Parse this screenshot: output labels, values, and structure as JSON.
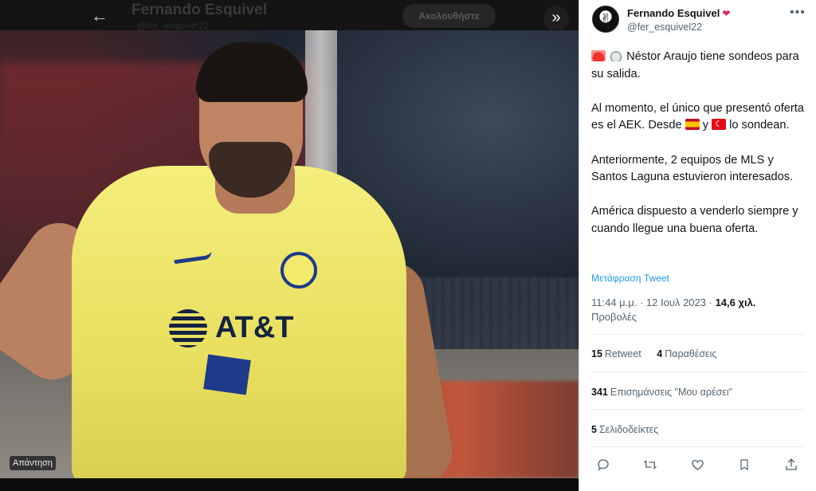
{
  "viewer": {
    "ghost_name": "Fernando Esquivel",
    "ghost_handle": "@fer_esquivel22",
    "follow_label": "Ακολουθήστε",
    "reply_label": "Απάντηση",
    "photo_sponsor": "AT&T"
  },
  "author": {
    "name": "Fernando Esquivel",
    "handle": "@fer_esquivel22",
    "badge_icon": "heart-red-icon"
  },
  "tweet": {
    "line1": "Néstor Araujo tiene sondeos para su salida.",
    "line2_a": "Al momento, el único que presentó oferta es el AEK. Desde",
    "line2_b": "y",
    "line2_c": "lo sondean.",
    "line3": "Anteriormente, 2 equipos de MLS y Santos Laguna estuvieron interesados.",
    "line4": "América dispuesto a venderlo siempre y cuando llegue una buena oferta.",
    "translate": "Μετάφραση Tweet"
  },
  "meta": {
    "time": "11:44 μ.μ. · 12 Ιουλ 2023 ·",
    "views_count": "14,6 χιλ.",
    "views_label": "Προβολές"
  },
  "stats": {
    "retweets_count": "15",
    "retweets_label": "Retweet",
    "quotes_count": "4",
    "quotes_label": "Παραθέσεις",
    "likes_count": "341",
    "likes_label": "Επισημάνσεις \"Μου αρέσει\"",
    "bookmarks_count": "5",
    "bookmarks_label": "Σελιδοδείκτες"
  },
  "colors": {
    "link": "#1d9bf0",
    "muted": "#536471",
    "text": "#0f1419"
  }
}
